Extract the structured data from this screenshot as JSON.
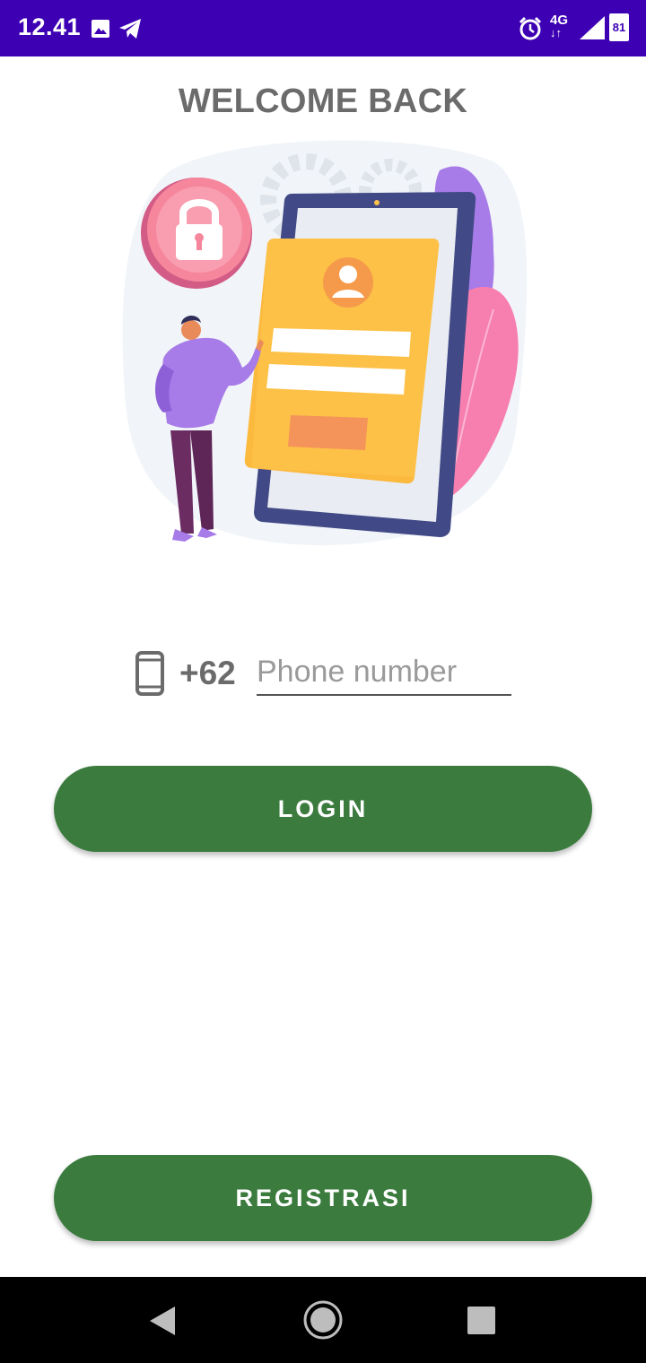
{
  "status_bar": {
    "time": "12.41",
    "network": "4G",
    "battery": "81",
    "background_color": "#3d00b3",
    "icons": [
      "image-icon",
      "telegram-icon",
      "alarm-icon",
      "network-4g-icon",
      "signal-icon",
      "battery-icon"
    ]
  },
  "header": {
    "title": "WELCOME BACK"
  },
  "illustration": {
    "icon": "login-illustration"
  },
  "login_form": {
    "phone_icon": "smartphone-icon",
    "country_code": "+62",
    "phone_placeholder": "Phone number",
    "phone_value": ""
  },
  "buttons": {
    "login_label": "LOGIN",
    "register_label": "REGISTRASI",
    "color": "#3b7c3e"
  },
  "nav_bar": {
    "icons": [
      "back-icon",
      "home-icon",
      "recents-icon"
    ]
  }
}
